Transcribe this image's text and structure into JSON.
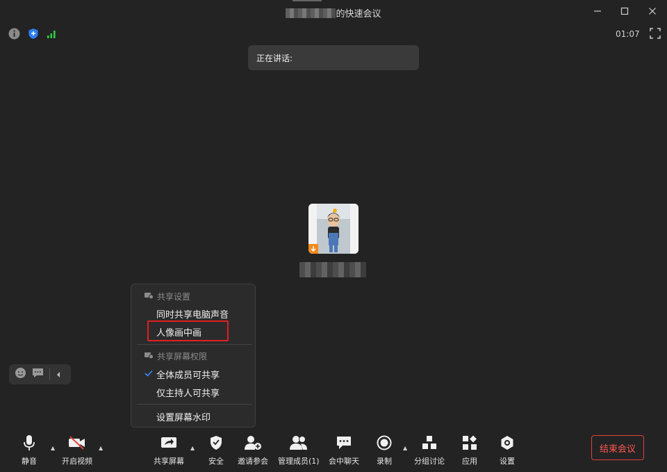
{
  "window": {
    "title_suffix": "的快速会议",
    "icons": [
      "minimize-icon",
      "maximize-icon",
      "close-icon"
    ]
  },
  "status": {
    "timer": "01:07",
    "icons": [
      "info-icon",
      "shield-icon",
      "signal-icon",
      "fullscreen-icon"
    ]
  },
  "speaking": {
    "label": "正在讲话:"
  },
  "share_menu": {
    "section1": "共享设置",
    "item_audio": "同时共享电脑声音",
    "item_pip": "人像画中画",
    "section2": "共享屏幕权限",
    "item_all": "全体成员可共享",
    "item_host": "仅主持人可共享",
    "item_watermark": "设置屏幕水印"
  },
  "toolbar": {
    "mute": "静音",
    "video": "开启视频",
    "share": "共享屏幕",
    "security": "安全",
    "invite": "邀请参会",
    "members": "管理成员(1)",
    "chat": "会中聊天",
    "record": "录制",
    "breakout": "分组讨论",
    "apps": "应用",
    "settings": "设置",
    "end": "结束会议"
  },
  "colors": {
    "background": "#232323",
    "accent_blue": "#3b8cff",
    "end_red": "#e0403a",
    "signal_green": "#2ecc40",
    "highlight_red": "#e02020"
  }
}
